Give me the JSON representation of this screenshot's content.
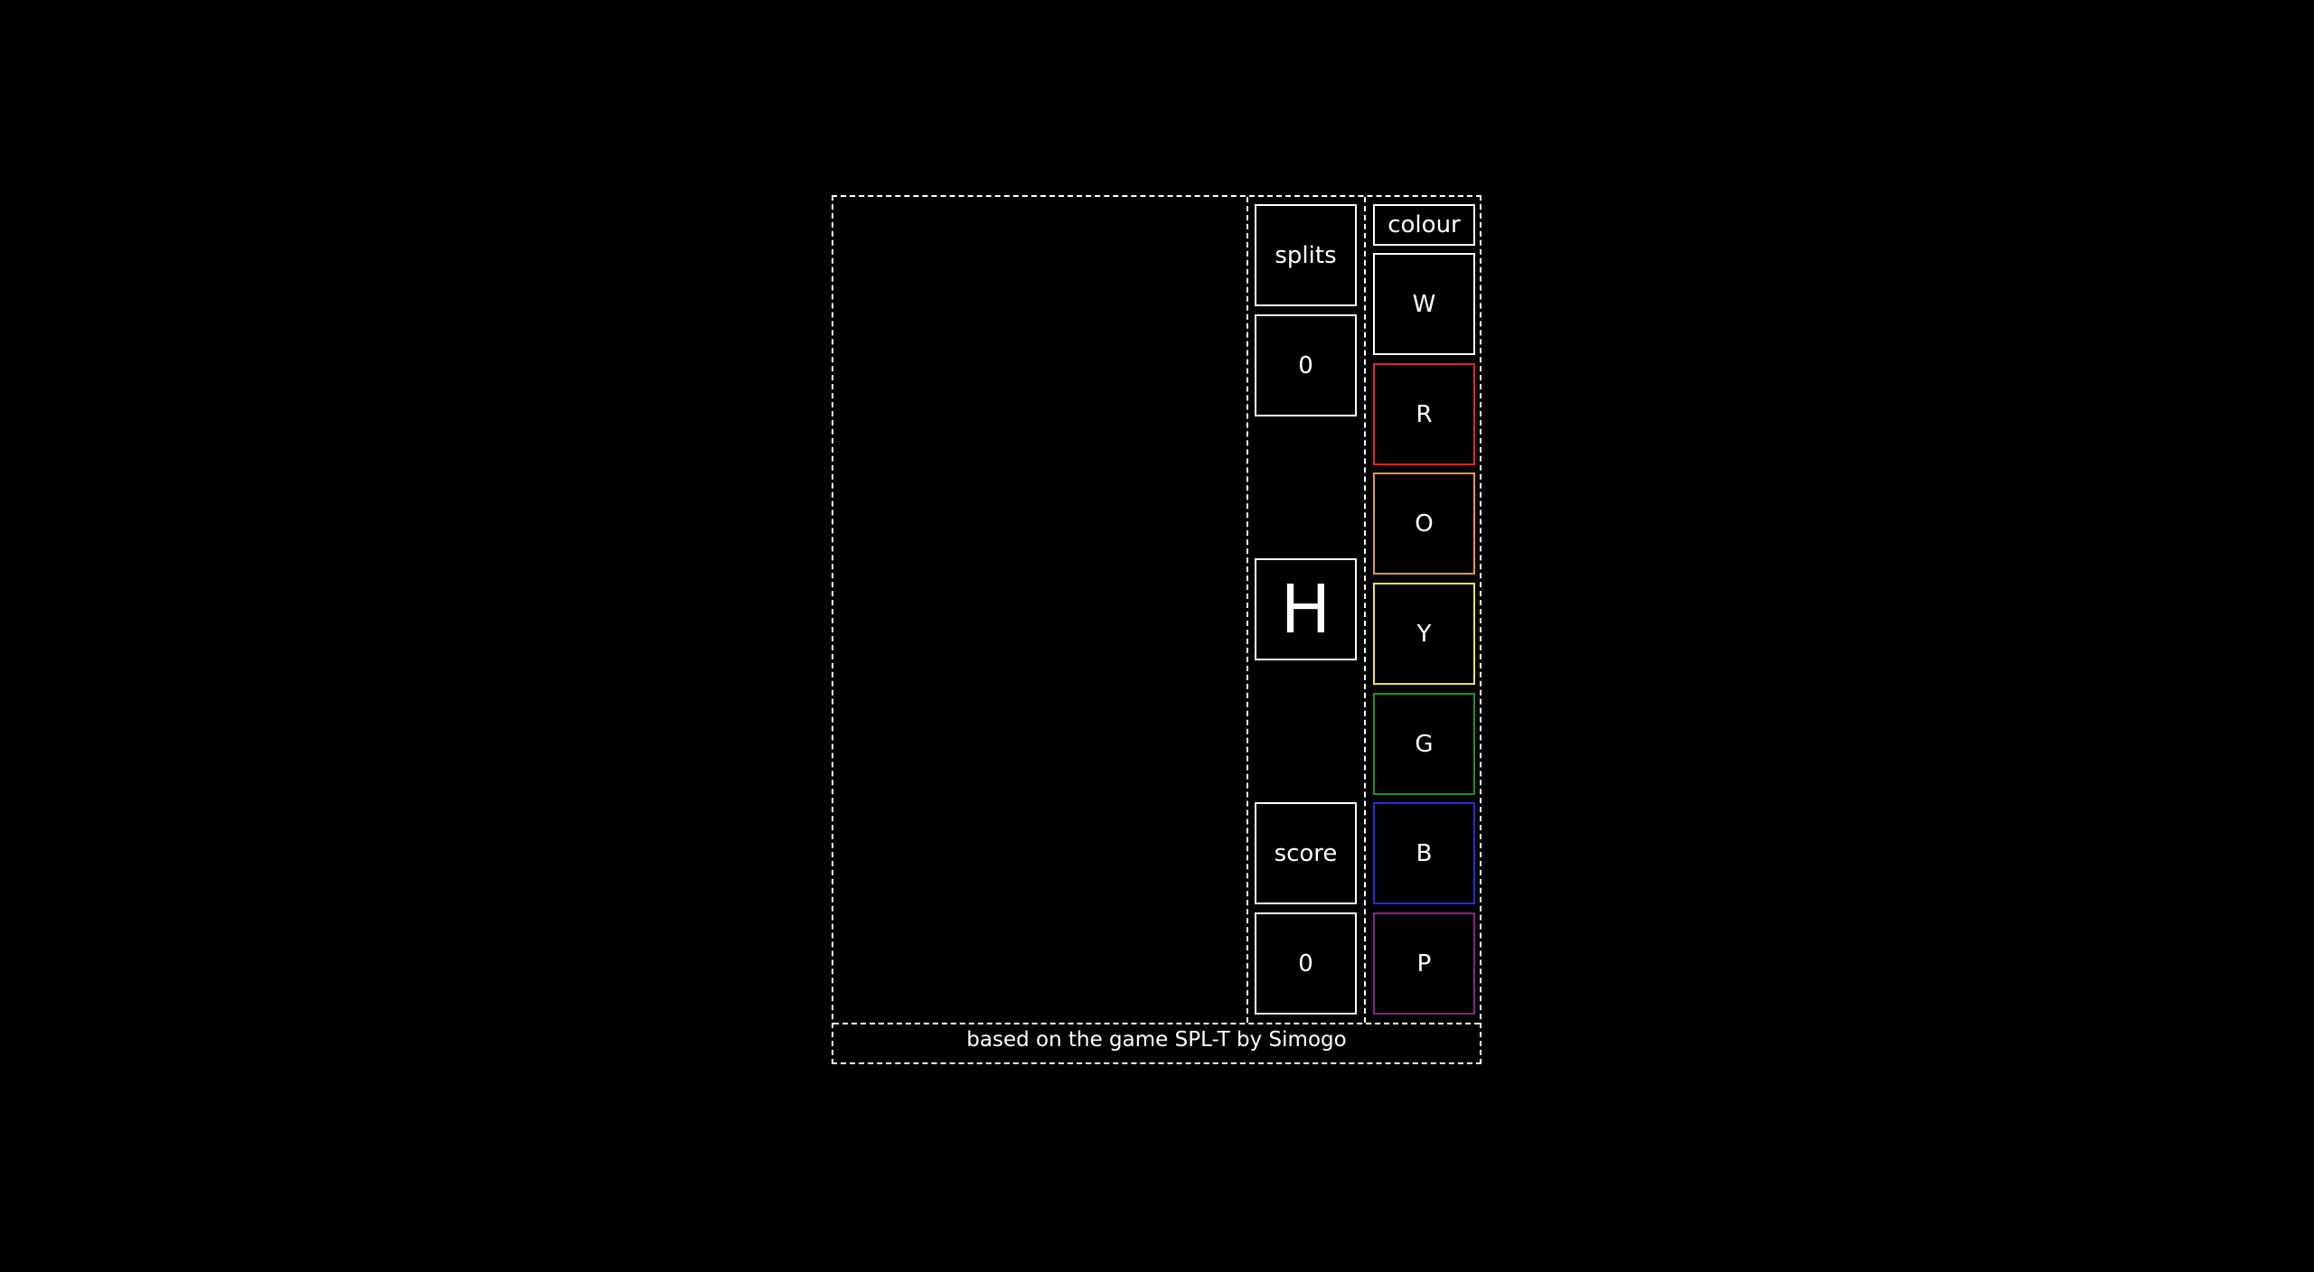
{
  "info": {
    "splits_label": "splits",
    "splits_value": "0",
    "next_piece": "H",
    "score_label": "score",
    "score_value": "0"
  },
  "colours": {
    "label": "colour",
    "items": [
      {
        "letter": "W",
        "color": "#ffffff"
      },
      {
        "letter": "R",
        "color": "#e0242a"
      },
      {
        "letter": "O",
        "color": "#e8953f"
      },
      {
        "letter": "Y",
        "color": "#efe34a"
      },
      {
        "letter": "G",
        "color": "#1e8f24"
      },
      {
        "letter": "B",
        "color": "#1f2ee2"
      },
      {
        "letter": "P",
        "color": "#8d2090"
      }
    ]
  },
  "footer": {
    "credit": "based on the game SPL-T by Simogo"
  }
}
